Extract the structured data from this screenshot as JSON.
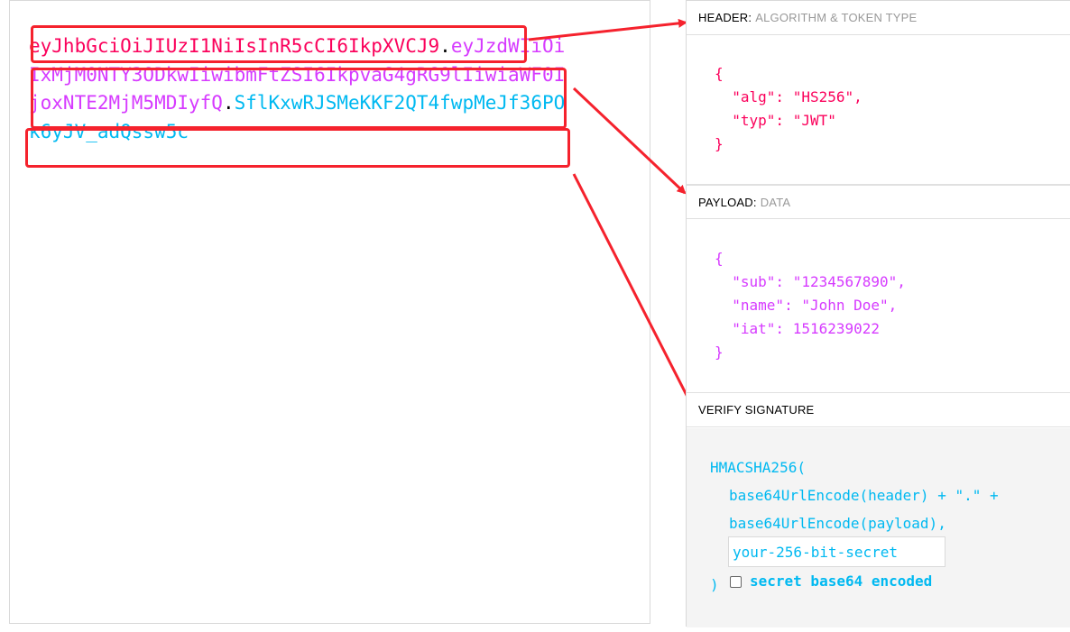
{
  "token": {
    "header": "eyJhbGciOiJIUzI1NiIsInR5cCI6IkpXVCJ9",
    "dot": ".",
    "payload": "eyJzdWIiOiIxMjM0NTY3ODkwIiwibmFtZSI6IkpvaG4gRG9lIiwiaWF0IjoxNTE2MjM5MDIyfQ",
    "signature": "SflKxwRJSMeKKF2QT4fwpMeJf36POk6yJV_adQssw5c"
  },
  "decoded": {
    "header_section": {
      "title": "HEADER:",
      "subtitle": "ALGORITHM & TOKEN TYPE",
      "lines": [
        "{",
        "  \"alg\": \"HS256\",",
        "  \"typ\": \"JWT\"",
        "}"
      ]
    },
    "payload_section": {
      "title": "PAYLOAD:",
      "subtitle": "DATA",
      "lines": [
        "{",
        "  \"sub\": \"1234567890\",",
        "  \"name\": \"John Doe\",",
        "  \"iat\": 1516239022",
        "}"
      ]
    },
    "signature_section": {
      "title": "VERIFY SIGNATURE",
      "func_open": "HMACSHA256(",
      "line1": "base64UrlEncode(header) + \".\" +",
      "line2": "base64UrlEncode(payload),",
      "secret_placeholder": "your-256-bit-secret",
      "close_paren": ")",
      "checkbox_label": "secret base64 encoded"
    }
  },
  "colors": {
    "header": "#fb015b",
    "payload": "#d63aff",
    "signature": "#00b9f1",
    "annotation": "#f5222d"
  }
}
